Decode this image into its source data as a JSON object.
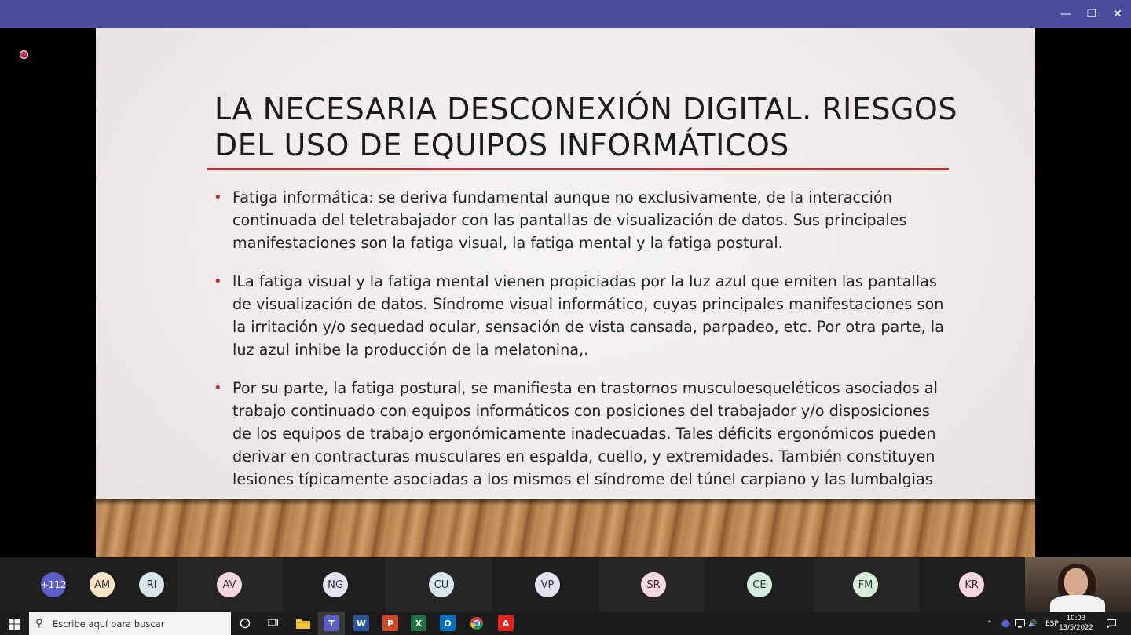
{
  "window": {
    "minimize_label": "—",
    "restore_label": "❐",
    "close_label": "✕"
  },
  "slide": {
    "title_line1": "LA NECESARIA DESCONEXIÓN DIGITAL. RIESGOS",
    "title_line2": "DEL USO DE EQUIPOS INFORMÁTICOS",
    "bullets": [
      {
        "text": "Fatiga informática: se deriva fundamental aunque no exclusivamente, de la interacción continuada del teletrabajador con las pantallas de visualización de datos. Sus principales manifestaciones son la fatiga visual, la fatiga mental y la fatiga postural."
      },
      {
        "text": "lLa fatiga visual y la fatiga mental vienen propiciadas por la luz azul que emiten las pantallas de visualización de datos. Síndrome visual informático, cuyas principales manifestaciones son la irritación y/o sequedad ocular, sensación de vista cansada, parpadeo, etc. Por otra parte, la luz azul inhibe la producción de la melatonina,."
      },
      {
        "text": "Por su parte, la fatiga postural, se manifiesta en trastornos musculoesqueléticos asociados al trabajo continuado con equipos informáticos con posiciones del trabajador y/o disposiciones de los equipos de trabajo ergonómicamente inadecuadas. Tales déficits ergonómicos pueden derivar en contracturas musculares en espalda, cuello, y extremidades. También constituyen lesiones típicamente asociadas a los mismos el síndrome del túnel carpiano y las lumbalgias"
      }
    ],
    "bullet_char": "•"
  },
  "participants": {
    "more_label": "+112",
    "avatars": [
      {
        "initials": "AM",
        "color": "#fbe3c9"
      },
      {
        "initials": "RI",
        "color": "#d7e4ea"
      },
      {
        "initials": "AV",
        "color": "#f6d6e0"
      },
      {
        "initials": "NG",
        "color": "#e6e1f1"
      },
      {
        "initials": "CU",
        "color": "#d8e6ee"
      },
      {
        "initials": "VP",
        "color": "#e3e0f2"
      },
      {
        "initials": "SR",
        "color": "#f5d7e2"
      },
      {
        "initials": "CE",
        "color": "#d4ecdc"
      },
      {
        "initials": "FM",
        "color": "#d6ebd8"
      },
      {
        "initials": "KR",
        "color": "#f6d6e0"
      }
    ]
  },
  "taskbar": {
    "search_placeholder": "Escribe aquí para buscar",
    "apps": [
      {
        "name": "word",
        "label": "W",
        "color": "#2b579a"
      },
      {
        "name": "powerpoint",
        "label": "P",
        "color": "#d24726"
      },
      {
        "name": "excel",
        "label": "X",
        "color": "#217346"
      },
      {
        "name": "outlook",
        "label": "O",
        "color": "#0072c6"
      },
      {
        "name": "chrome",
        "label": "",
        "color": "#db4437"
      },
      {
        "name": "acrobat",
        "label": "A",
        "color": "#e2231a"
      }
    ],
    "language": "ESP",
    "time": "10:03",
    "date": "13/5/2022"
  },
  "colors": {
    "titlebar": "#4b4c9d",
    "accent_rule": "#c0303b",
    "teams": "#5b5fc7"
  }
}
